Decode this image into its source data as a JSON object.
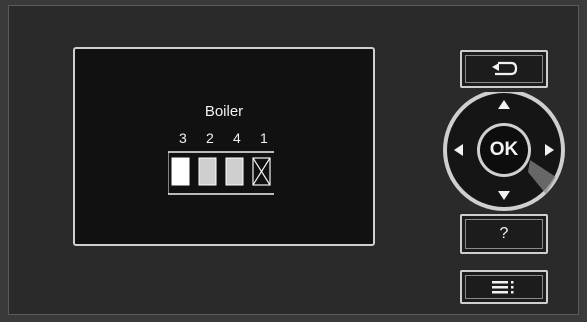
{
  "display": {
    "title": "Boiler",
    "boiler_numbers": [
      "3",
      "2",
      "4",
      "1"
    ],
    "boiler_states": [
      "on",
      "partial",
      "partial",
      "off"
    ]
  },
  "controls": {
    "ok_label": "OK",
    "help_label": "?",
    "back_icon": "back-arrow-icon",
    "menu_icon": "menu-icon"
  },
  "colors": {
    "screen_bg": "#111111",
    "panel_bg": "#2a2a2a",
    "text": "#f2f2f2",
    "border": "#cfcfcf"
  }
}
